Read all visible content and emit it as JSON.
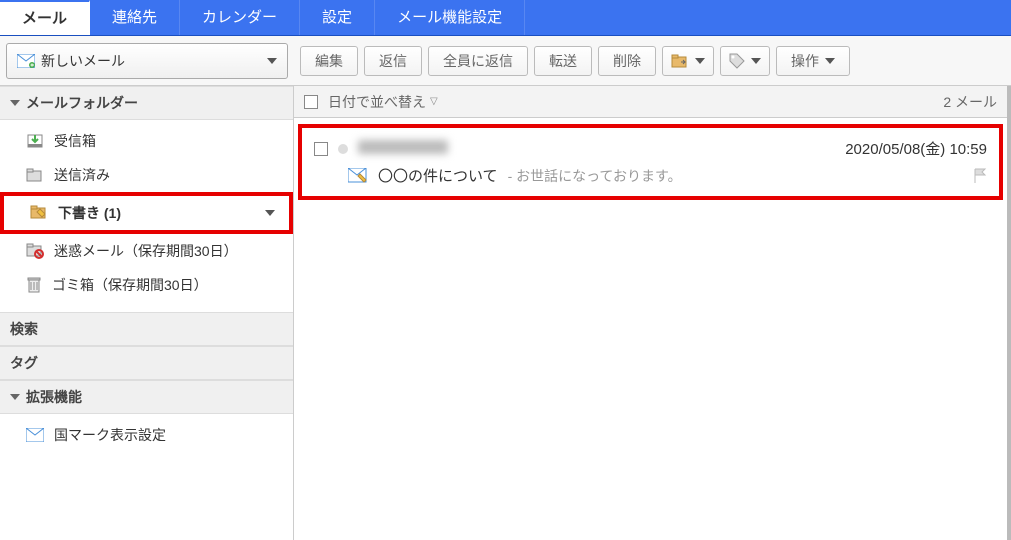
{
  "topnav": {
    "tabs": [
      {
        "label": "メール",
        "active": true
      },
      {
        "label": "連絡先"
      },
      {
        "label": "カレンダー"
      },
      {
        "label": "設定"
      },
      {
        "label": "メール機能設定"
      }
    ]
  },
  "newMail": {
    "label": "新しいメール"
  },
  "toolbar": {
    "edit": "編集",
    "reply": "返信",
    "replyAll": "全員に返信",
    "forward": "転送",
    "delete": "削除",
    "actions": "操作"
  },
  "sidebar": {
    "foldersHeader": "メールフォルダー",
    "folders": [
      {
        "label": "受信箱",
        "icon": "inbox"
      },
      {
        "label": "送信済み",
        "icon": "sent"
      },
      {
        "label": "下書き (1)",
        "icon": "draft",
        "highlighted": true,
        "hasDropdown": true
      },
      {
        "label": "迷惑メール（保存期間30日）",
        "icon": "spam"
      },
      {
        "label": "ゴミ箱（保存期間30日）",
        "icon": "trash"
      }
    ],
    "searchHeader": "検索",
    "tagHeader": "タグ",
    "extHeader": "拡張機能",
    "extItems": [
      {
        "label": "国マーク表示設定",
        "icon": "mail"
      }
    ]
  },
  "list": {
    "sortLabel": "日付で並べ替え",
    "countLabel": "2 メール",
    "messages": [
      {
        "senderRedacted": true,
        "date": "2020/05/08(金) 10:59",
        "subject": "〇〇の件について",
        "previewSeparator": " - ",
        "preview": "お世話になっております。"
      }
    ]
  }
}
